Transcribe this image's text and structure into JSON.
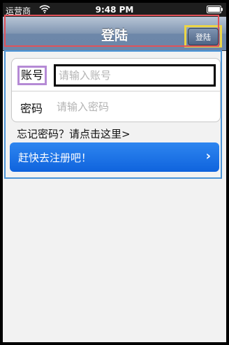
{
  "status_bar": {
    "carrier": "运营商",
    "time": "9:48 PM",
    "wifi_icon": "wifi-icon",
    "battery_icon": "battery-icon"
  },
  "nav_bar": {
    "title": "登陆",
    "right_button_label": "登陆"
  },
  "form": {
    "account": {
      "label": "账号",
      "placeholder": "请输入账号",
      "value": ""
    },
    "password": {
      "label": "密码",
      "placeholder": "请输入密码",
      "value": ""
    }
  },
  "forgot_password_link": "忘记密码？请点击这里>",
  "register_button": {
    "label": "赶快去注册吧！",
    "icon": "chevron-right-icon"
  },
  "colors": {
    "nav_gradient_top": "#b7c4d5",
    "nav_gradient_bottom": "#6c86a8",
    "register_blue": "#1a73e8",
    "outline_red": "#e0525a",
    "outline_yellow": "#ecd545",
    "outline_blue": "#4b94d6",
    "outline_purple": "#b58ad5"
  }
}
